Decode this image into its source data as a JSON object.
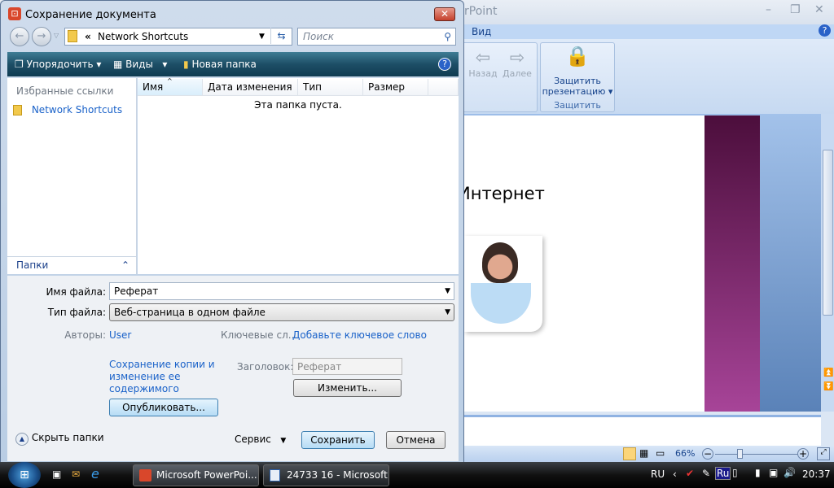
{
  "powerpoint": {
    "title_fragment": "rPoint",
    "tab_view": "Вид",
    "back": "Назад",
    "forward": "Далее",
    "protect_btn_line1": "Защитить",
    "protect_btn_line2": "презентацию",
    "group_protect": "Защитить",
    "slide_title_fragment": "Интернет",
    "zoom": "66%"
  },
  "dialog": {
    "title": "Сохранение документа",
    "address": "Network Shortcuts",
    "address_prefix": "«",
    "search_placeholder": "Поиск",
    "toolbar": {
      "organize": "Упорядочить",
      "views": "Виды",
      "new_folder": "Новая папка"
    },
    "favorites_header": "Избранные ссылки",
    "favorites": [
      {
        "label": "Network Shortcuts"
      }
    ],
    "folders": "Папки",
    "columns": [
      "Имя",
      "Дата изменения",
      "Тип",
      "Размер"
    ],
    "empty_message": "Эта папка пуста.",
    "filename_label": "Имя файла:",
    "filename": "Реферат",
    "filetype_label": "Тип файла:",
    "filetype": "Веб-страница в одном файле",
    "authors_label": "Авторы:",
    "authors": "User",
    "keywords_label": "Ключевые сл...",
    "keywords_placeholder": "Добавьте ключевое слово",
    "save_copy_link": "Сохранение копии и изменение ее содержимого",
    "title_label": "Заголовок:",
    "title_value": "Реферат",
    "change_btn": "Изменить...",
    "publish_btn": "Опубликовать...",
    "hide_folders": "Скрыть папки",
    "tools": "Сервис",
    "save": "Сохранить",
    "cancel": "Отмена"
  },
  "taskbar": {
    "tasks": [
      "Microsoft PowerPoi...",
      "24733 16 - Microsoft..."
    ],
    "lang": "RU",
    "ime": "Ru",
    "clock": "20:37"
  }
}
